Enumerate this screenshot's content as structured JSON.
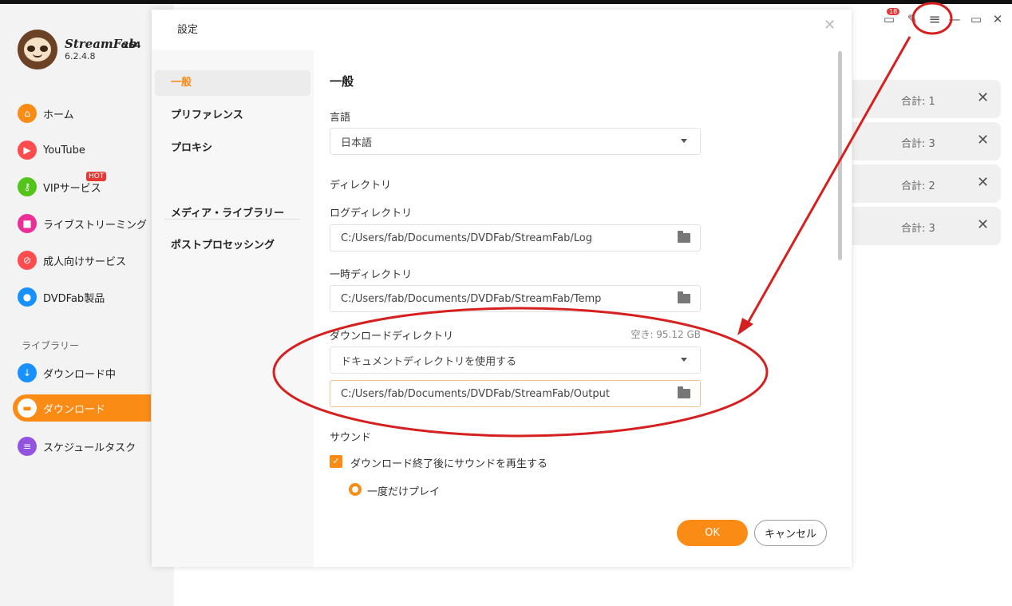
{
  "app": {
    "brand": "StreamFab",
    "arch": "x64",
    "version": "6.2.4.8",
    "notification_count": "18"
  },
  "sidebar": {
    "items": [
      {
        "label": "ホーム",
        "icon": "home-icon",
        "color": "#fa8c16"
      },
      {
        "label": "YouTube",
        "icon": "youtube-icon",
        "color": "#ff4d4f"
      },
      {
        "label": "VIPサービス",
        "icon": "key-icon",
        "color": "#52c41a"
      },
      {
        "label": "ライブストリーミング",
        "icon": "live-camera-icon",
        "color": "#eb2f96"
      },
      {
        "label": "成人向けサービス",
        "icon": "adult-restricted-icon",
        "color": "#ff4d4f"
      },
      {
        "label": "DVDFab製品",
        "icon": "dvdfab-icon",
        "color": "#1890ff"
      }
    ],
    "hot_badge": "HOT",
    "library_label": "ライブラリー",
    "library_items": [
      {
        "label": "ダウンロード中",
        "icon": "download-arrow-icon",
        "color": "#1890ff"
      },
      {
        "label": "ダウンロード",
        "icon": "folder-icon",
        "color": "#fa8c16",
        "active": true
      },
      {
        "label": "スケジュールタスク",
        "icon": "schedule-list-icon",
        "color": "#9254de"
      }
    ]
  },
  "background_list": {
    "rows": [
      {
        "total": "合計: 1"
      },
      {
        "total": "合計: 3"
      },
      {
        "total": "合計: 2"
      },
      {
        "total": "合計: 3"
      }
    ]
  },
  "dialog": {
    "title": "設定",
    "nav": [
      "一般",
      "プリファレンス",
      "プロキシ",
      "メディア・ライブラリー",
      "ポストプロセッシング"
    ],
    "section_title": "一般",
    "language_label": "言語",
    "language_value": "日本語",
    "directory_label": "ディレクトリ",
    "log_dir_label": "ログディレクトリ",
    "log_dir_value": "C:/Users/fab/Documents/DVDFab/StreamFab/Log",
    "temp_dir_label": "一時ディレクトリ",
    "temp_dir_value": "C:/Users/fab/Documents/DVDFab/StreamFab/Temp",
    "download_dir_label": "ダウンロードディレクトリ",
    "free_space": "空き: 95.12 GB",
    "download_dir_mode": "ドキュメントディレクトリを使用する",
    "download_dir_value": "C:/Users/fab/Documents/DVDFab/StreamFab/Output",
    "sound_label": "サウンド",
    "play_sound_label": "ダウンロード終了後にサウンドを再生する",
    "play_once_label": "一度だけプレイ",
    "ok_label": "OK",
    "cancel_label": "キャンセル"
  },
  "annotation_color": "#d62020",
  "accent_color": "#fa8c16"
}
